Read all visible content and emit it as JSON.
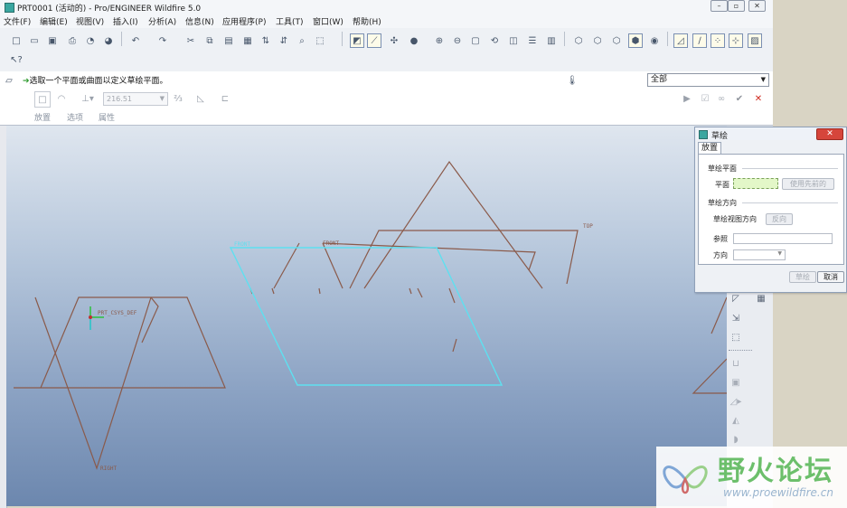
{
  "window": {
    "title": "PRT0001 (活动的) - Pro/ENGINEER Wildfire 5.0"
  },
  "menubar": {
    "items": [
      "文件(F)",
      "编辑(E)",
      "视图(V)",
      "插入(I)",
      "分析(A)",
      "信息(N)",
      "应用程序(P)",
      "工具(T)",
      "窗口(W)",
      "帮助(H)"
    ]
  },
  "dashboard": {
    "message": "选取一个平面或曲面以定义草绘平面。",
    "filter_value": "全部",
    "dimension_value": "216.51",
    "tabs": [
      "放置",
      "选项",
      "属性"
    ]
  },
  "datums": {
    "front_top": "FRONT",
    "front_bottom": "FRONT",
    "top": "TOP",
    "csys": "PRT_CSYS_DEF",
    "right": "RIGHT"
  },
  "dialog": {
    "title": "草绘",
    "close_label": "✕",
    "tab": "放置",
    "group_plane": "草绘平面",
    "plane_label": "平面",
    "use_previous": "使用先前的",
    "group_orientation": "草绘方向",
    "view_direction_label": "草绘视图方向",
    "flip_button": "反向",
    "reference_label": "参照",
    "orientation_label": "方向",
    "sketch_button": "草绘",
    "cancel_button": "取消"
  },
  "watermark": {
    "text": "野火论坛",
    "url": "www.proewildfire.cn"
  },
  "colors": {
    "datum_plane": "#8a5a4a",
    "selected_plane": "#5ee0f0",
    "plane_field": "#e3f7c8",
    "close_red": "#d6453b"
  }
}
